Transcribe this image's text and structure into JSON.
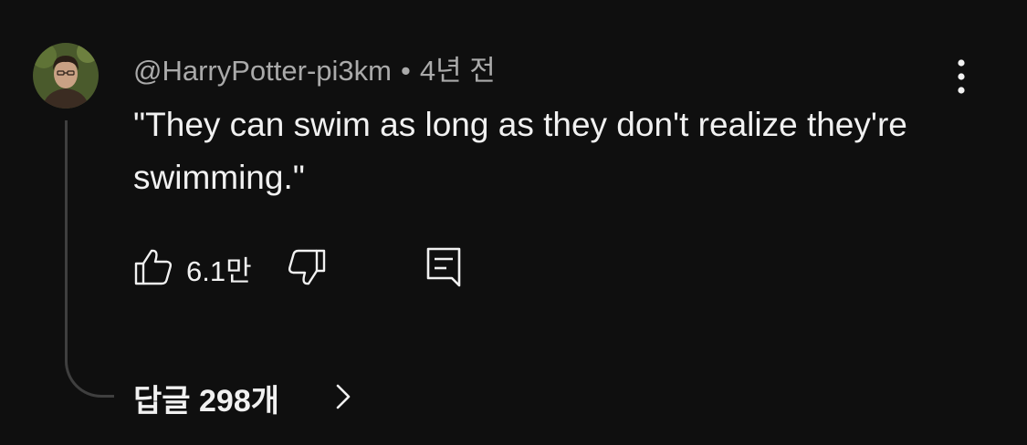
{
  "comment": {
    "author": "@HarryPotter-pi3km",
    "separator": "•",
    "time": "4년 전",
    "text": "\"They can swim as long as they don't realize they're swimming.\"",
    "like_count": "6.1만",
    "replies_label": "답글 298개"
  },
  "icons": {
    "avatar": "avatar",
    "like": "thumbs-up-icon",
    "dislike": "thumbs-down-icon",
    "reply": "comment-icon",
    "more": "more-vertical-icon",
    "chevron": "chevron-right-icon"
  },
  "colors": {
    "background": "#0f0f0f",
    "text_primary": "#f1f1f1",
    "text_secondary": "#aaaaaa",
    "thread_line": "#3f3f3f"
  }
}
